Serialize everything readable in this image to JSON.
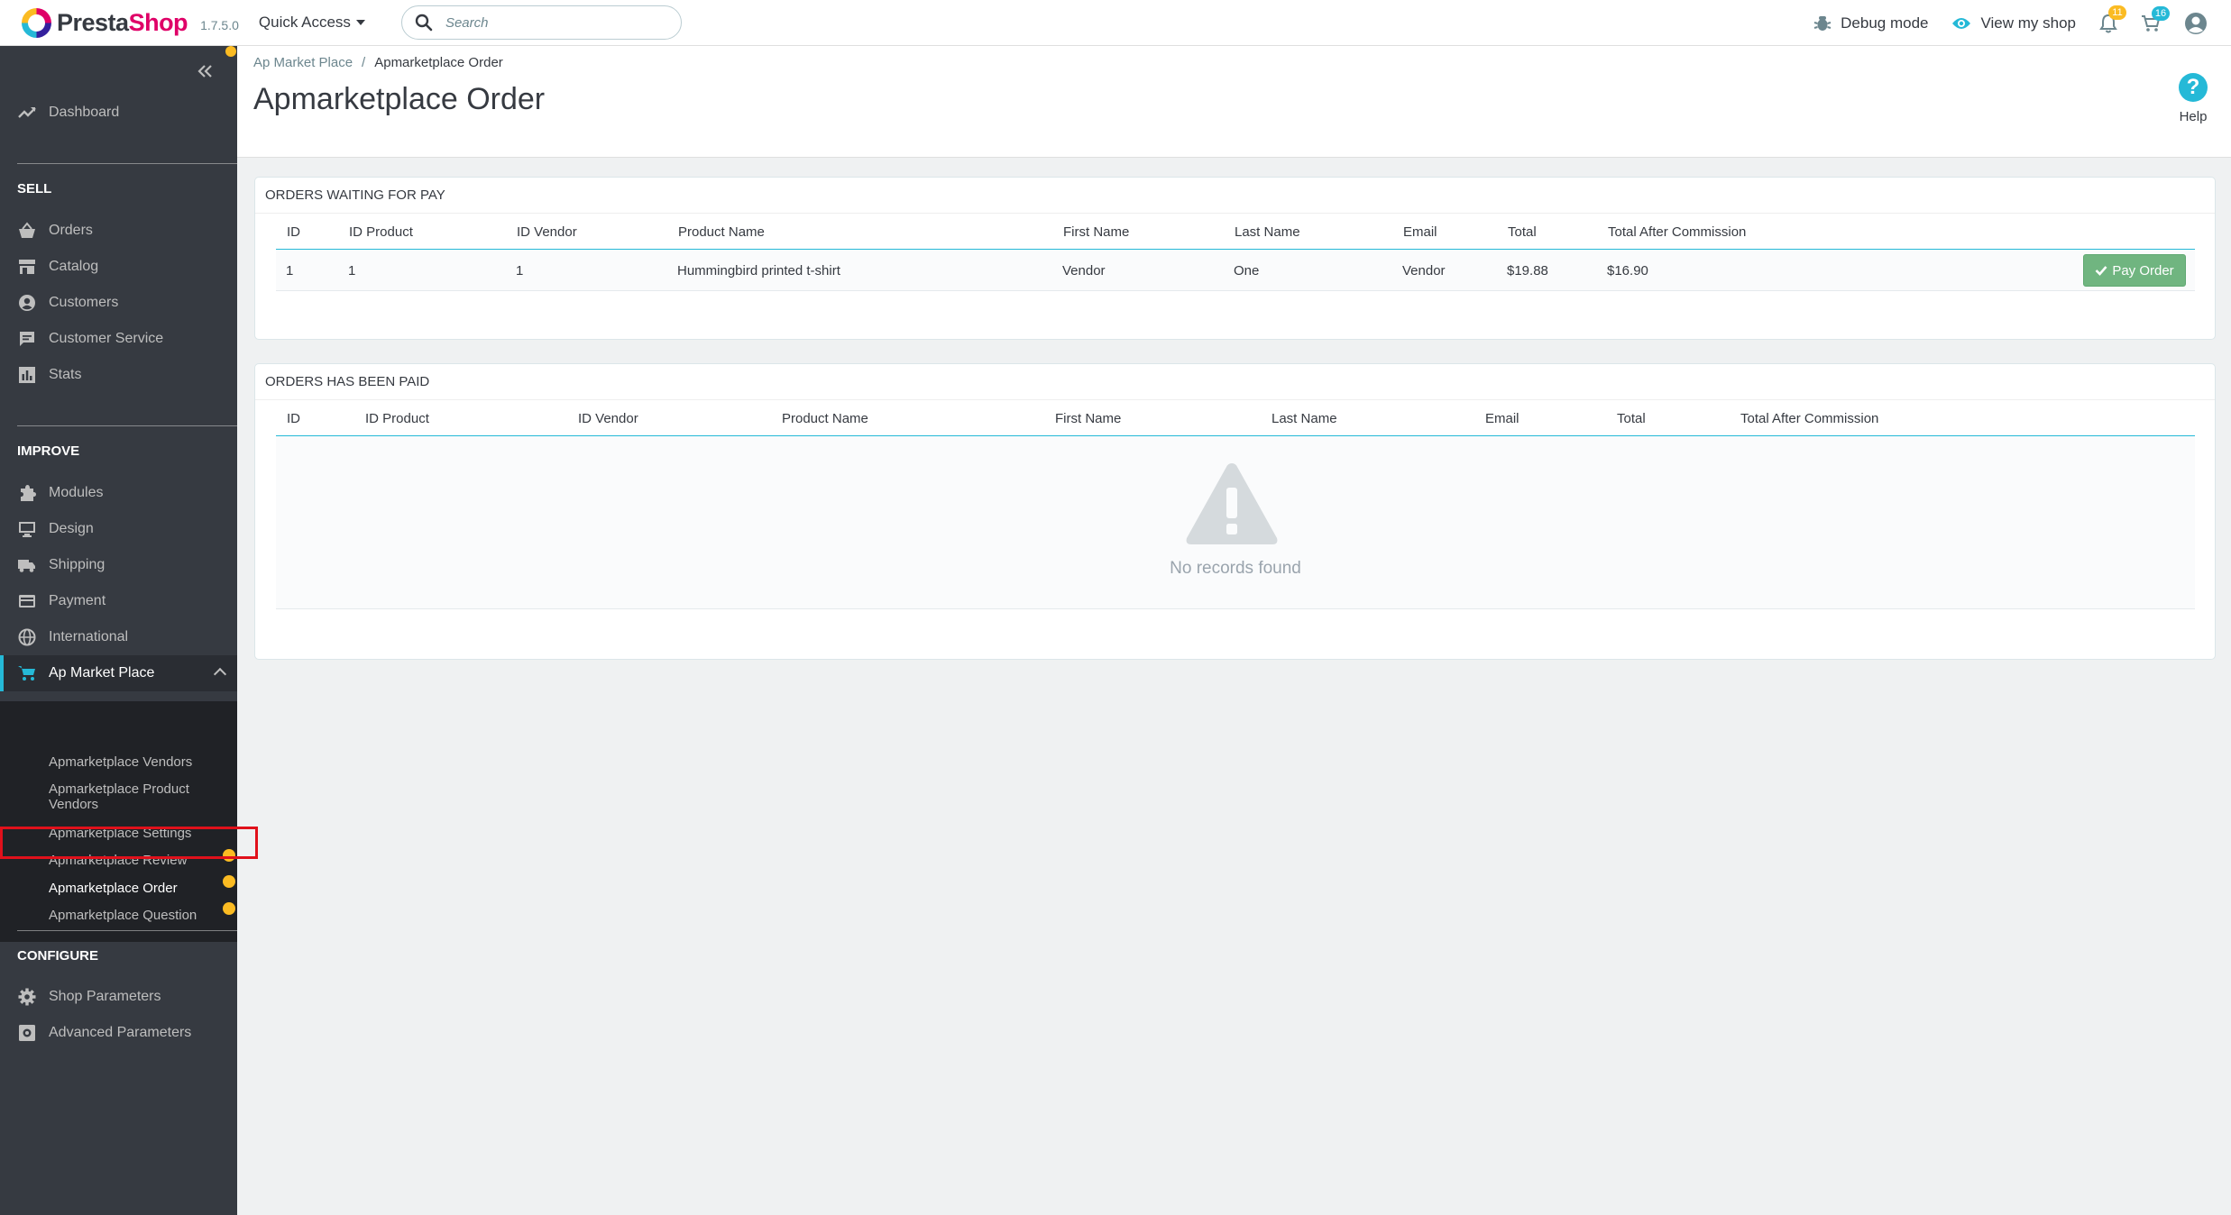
{
  "header": {
    "logo_text_a": "Presta",
    "logo_text_b": "Shop",
    "version": "1.7.5.0",
    "quick_access": "Quick Access",
    "search_placeholder": "Search",
    "debug_mode": "Debug mode",
    "view_shop": "View my shop",
    "notifications_count": "11",
    "cart_count": "16"
  },
  "sidebar": {
    "dashboard": "Dashboard",
    "sell_title": "SELL",
    "sell_items": [
      "Orders",
      "Catalog",
      "Customers",
      "Customer Service",
      "Stats"
    ],
    "improve_title": "IMPROVE",
    "improve_items": [
      "Modules",
      "Design",
      "Shipping",
      "Payment",
      "International"
    ],
    "active_item": "Ap Market Place",
    "submenu": [
      "Apmarketplace Vendors",
      "Apmarketplace Product Vendors",
      "Apmarketplace Settings",
      "Apmarketplace Review",
      "Apmarketplace Order",
      "Apmarketplace Question"
    ],
    "configure_title": "CONFIGURE",
    "configure_items": [
      "Shop Parameters",
      "Advanced Parameters"
    ]
  },
  "toolbar": {
    "breadcrumb_parent": "Ap Market Place",
    "breadcrumb_sep": "/",
    "breadcrumb_current": "Apmarketplace Order",
    "title": "Apmarketplace Order",
    "help": "Help"
  },
  "waiting": {
    "heading": "ORDERS WAITING FOR PAY",
    "columns": [
      "ID",
      "ID Product",
      "ID Vendor",
      "Product Name",
      "First Name",
      "Last Name",
      "Email",
      "Total",
      "Total After Commission"
    ],
    "rows": [
      [
        "1",
        "1",
        "1",
        "Hummingbird printed t-shirt",
        "Vendor",
        "One",
        "Vendor",
        "$19.88",
        "$16.90"
      ]
    ],
    "pay_button": "Pay Order"
  },
  "paid": {
    "heading": "ORDERS HAS BEEN PAID",
    "columns": [
      "ID",
      "ID Product",
      "ID Vendor",
      "Product Name",
      "First Name",
      "Last Name",
      "Email",
      "Total",
      "Total After Commission"
    ],
    "empty_text": "No records found"
  },
  "colors": {
    "brand_pink": "#df0067",
    "accent_blue": "#25b9d7",
    "sidebar_bg": "#363a41",
    "success_green": "#70b580",
    "badge_yellow": "#fbbb22",
    "highlight_red": "#e0111b"
  }
}
